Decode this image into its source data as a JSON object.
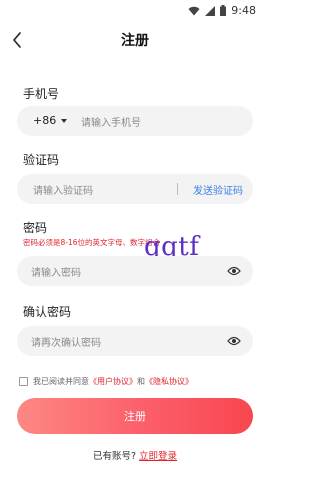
{
  "status_bar": {
    "time": "9:48",
    "icons": [
      "wifi-icon",
      "signal-icon",
      "battery-icon"
    ]
  },
  "header": {
    "title": "注册",
    "back_icon": "back-arrow-icon"
  },
  "phone": {
    "label": "手机号",
    "country_code": "+86",
    "placeholder": "请输入手机号"
  },
  "verify": {
    "label": "验证码",
    "placeholder": "请输入验证码",
    "send_label": "发送验证码"
  },
  "password": {
    "label": "密码",
    "hint": "密码必须是8-16位的英文字母、数字组合",
    "placeholder": "请输入密码",
    "eye_icon": "eye-icon"
  },
  "confirm": {
    "label": "确认密码",
    "placeholder": "请再次确认密码",
    "eye_icon": "eye-icon"
  },
  "agreement": {
    "prefix": "我已阅读并同意",
    "user_agreement": "《用户协议》",
    "and": "和",
    "privacy_policy": "《隐私协议》",
    "checked": false
  },
  "register_button": {
    "label": "注册"
  },
  "login_prompt": {
    "text": "已有账号?",
    "link": "立即登录"
  },
  "watermark": "qqtf",
  "colors": {
    "accent_red": "#e0242b",
    "link_blue": "#3a82e8",
    "button_gradient_start": "#fd8882",
    "button_gradient_end": "#f8464f",
    "field_bg": "#f3f3f3"
  }
}
